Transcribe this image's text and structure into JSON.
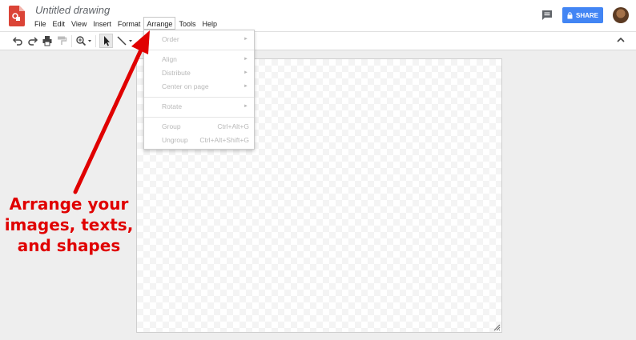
{
  "app": {
    "title": "Untitled drawing"
  },
  "menus": [
    "File",
    "Edit",
    "View",
    "Insert",
    "Format",
    "Arrange",
    "Tools",
    "Help"
  ],
  "header": {
    "share_label": "SHARE",
    "icons": [
      "drawings-logo-icon",
      "comments-icon",
      "lock-icon",
      "avatar"
    ]
  },
  "arrange_menu": {
    "items": [
      {
        "label": "Order",
        "submenu": true
      },
      {
        "label": "Align",
        "submenu": true
      },
      {
        "label": "Distribute",
        "submenu": true
      },
      {
        "label": "Center on page",
        "submenu": true
      },
      {
        "label": "Rotate",
        "submenu": true
      },
      {
        "label": "Group",
        "shortcut": "Ctrl+Alt+G"
      },
      {
        "label": "Ungroup",
        "shortcut": "Ctrl+Alt+Shift+G"
      }
    ],
    "disabled": true
  },
  "annotation": {
    "line1": "Arrange your",
    "line2": "images, texts,",
    "line3": "and shapes",
    "color": "#e00000"
  },
  "colors": {
    "accent": "#4285f4",
    "logo": "#db4437"
  }
}
